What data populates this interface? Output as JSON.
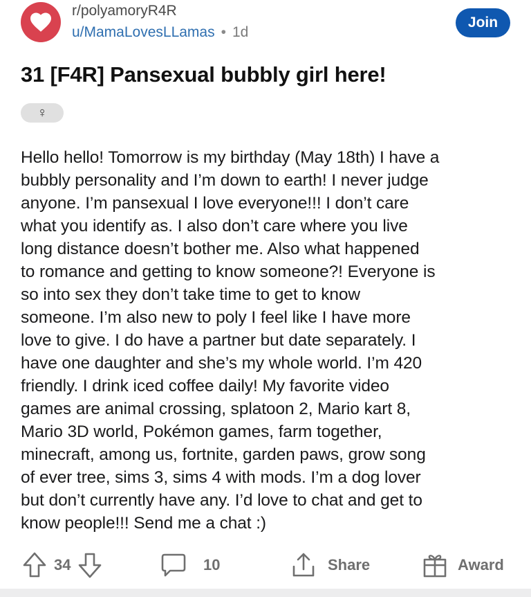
{
  "colors": {
    "avatar_bg": "#d9424f",
    "join_bg": "#0f58b0",
    "username": "#2f6fb0"
  },
  "header": {
    "subreddit": "r/polyamoryR4R",
    "username": "u/MamaLovesLLamas",
    "separator": "•",
    "age": "1d",
    "join_label": "Join",
    "avatar_icon": "heart-icon"
  },
  "post": {
    "title": "31 [F4R] Pansexual bubbly girl here!",
    "flair": "♀",
    "body_lines": [
      "Hello hello! Tomorrow is my birthday (May 18th) I have a",
      "bubbly personality and I’m down to earth! I never judge",
      "anyone. I’m pansexual I love everyone!!! I don’t care",
      "what you identify as. I also don’t care where you live",
      "long distance doesn’t bother me. Also what happened",
      "to romance and getting to know someone?! Everyone is",
      "so into sex they don’t take time to get to know",
      "someone. I’m also new to poly I feel like I have more",
      "love to give. I do have a partner but date separately. I",
      "have one daughter and she’s my whole world. I’m 420",
      "friendly. I drink iced coffee daily! My favorite video",
      "games are animal crossing, splatoon 2, Mario kart 8,",
      "Mario 3D world, Pokémon games, farm together,",
      "minecraft, among us, fortnite, garden paws, grow song",
      "of ever tree, sims 3, sims 4 with mods. I’m a dog lover",
      "but don’t currently have any. I’d love to chat and get to",
      "know people!!! Send me a chat :)"
    ]
  },
  "actions": {
    "upvotes": "34",
    "comments": "10",
    "share_label": "Share",
    "award_label": "Award"
  }
}
